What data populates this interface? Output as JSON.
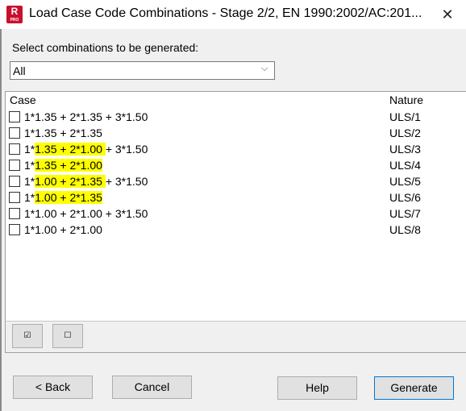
{
  "window": {
    "title": "Load Case Code Combinations - Stage 2/2, EN 1990:2002/AC:201...",
    "app_icon_letter": "R",
    "app_icon_sub": "PRO",
    "close_glyph": "✕"
  },
  "filter": {
    "label": "Select combinations to be generated:",
    "selected": "All",
    "chevron": "⌵"
  },
  "table": {
    "columns": {
      "case": "Case",
      "nature": "Nature"
    },
    "rows": [
      {
        "pre": "1*1.35 + 2*1.35 + 3*1.50",
        "hl": "",
        "post": "",
        "nature": "ULS/1",
        "checked": false
      },
      {
        "pre": "1*1.35 + 2*1.35",
        "hl": "",
        "post": "",
        "nature": "ULS/2",
        "checked": false
      },
      {
        "pre": "1*",
        "hl": "1.35 + 2*1.00 ",
        "post": "+ 3*1.50",
        "nature": "ULS/3",
        "checked": false
      },
      {
        "pre": "1*",
        "hl": "1.35 + 2*1.00",
        "post": "",
        "nature": "ULS/4",
        "checked": false
      },
      {
        "pre": "1*",
        "hl": "1.00 + 2*1.35 ",
        "post": "+ 3*1.50",
        "nature": "ULS/5",
        "checked": false
      },
      {
        "pre": "1*",
        "hl": "1.00 + 2*1.35",
        "post": "",
        "nature": "ULS/6",
        "checked": false
      },
      {
        "pre": "1*1.00 + 2*1.00 + 3*1.50",
        "hl": "",
        "post": "",
        "nature": "ULS/7",
        "checked": false
      },
      {
        "pre": "1*1.00 + 2*1.00",
        "hl": "",
        "post": "",
        "nature": "ULS/8",
        "checked": false
      }
    ],
    "highlight_color": "#ffff00"
  },
  "tools": {
    "select_all_glyph": "☑",
    "deselect_all_glyph": "☐"
  },
  "buttons": {
    "back": "< Back",
    "cancel": "Cancel",
    "help": "Help",
    "generate": "Generate"
  },
  "colors": {
    "brand": "#c8102e",
    "default_button_border": "#0078d7"
  }
}
